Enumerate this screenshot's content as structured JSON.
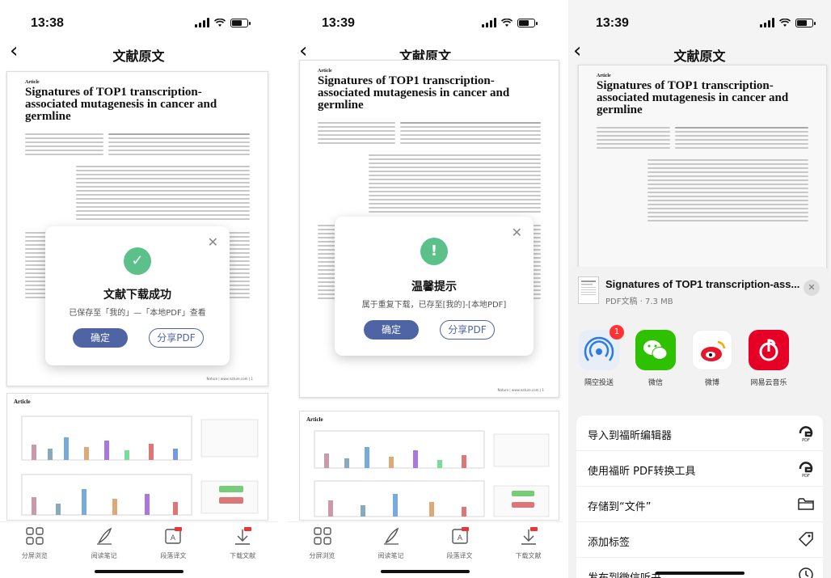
{
  "screens": [
    {
      "time": "13:38",
      "nav_title": "文献原文",
      "doc": {
        "kind": "Article",
        "title": "Signatures of TOP1 transcription-associated mutagenesis in cancer and germline",
        "footer": "Nature | www.nature.com | 1"
      },
      "fig_kind": "Article",
      "dialog": {
        "title": "文献下载成功",
        "message": "已保存至「我的」—「本地PDF」查看",
        "confirm": "确定",
        "share": "分享PDF"
      },
      "tabs": [
        "分屏浏览",
        "阅读笔记",
        "段落译文",
        "下载文献"
      ]
    },
    {
      "time": "13:39",
      "nav_title": "文献原文",
      "doc": {
        "kind": "Article",
        "title": "Signatures of TOP1 transcription-associated mutagenesis in cancer and germline",
        "footer": "Nature | www.nature.com | 1"
      },
      "fig_kind": "Article",
      "dialog": {
        "title": "温馨提示",
        "message": "属于重复下载，已存至[我的]-[本地PDF]",
        "confirm": "确定",
        "share": "分享PDF"
      },
      "tabs": [
        "分屏浏览",
        "阅读笔记",
        "段落译文",
        "下载文献"
      ]
    },
    {
      "time": "13:39",
      "nav_title": "文献原文",
      "doc": {
        "kind": "Article",
        "title": "Signatures of TOP1 transcription-associated mutagenesis in cancer and germline"
      },
      "share_sheet": {
        "title": "Signatures of TOP1 transcription-ass...",
        "subtitle": "PDF文稿 · 7.3 MB",
        "apps": [
          {
            "label": "隔空投送",
            "badge": "1"
          },
          {
            "label": "微信"
          },
          {
            "label": "微博"
          },
          {
            "label": "网易云音乐"
          }
        ],
        "actions": [
          "导入到福昕编辑器",
          "使用福昕 PDF转换工具",
          "存储到“文件”",
          "添加标签",
          "发布到微信听书"
        ]
      }
    }
  ],
  "colors": {
    "accent": "#4f64a5",
    "success": "#5cc08a",
    "warning": "#5cc08a"
  }
}
